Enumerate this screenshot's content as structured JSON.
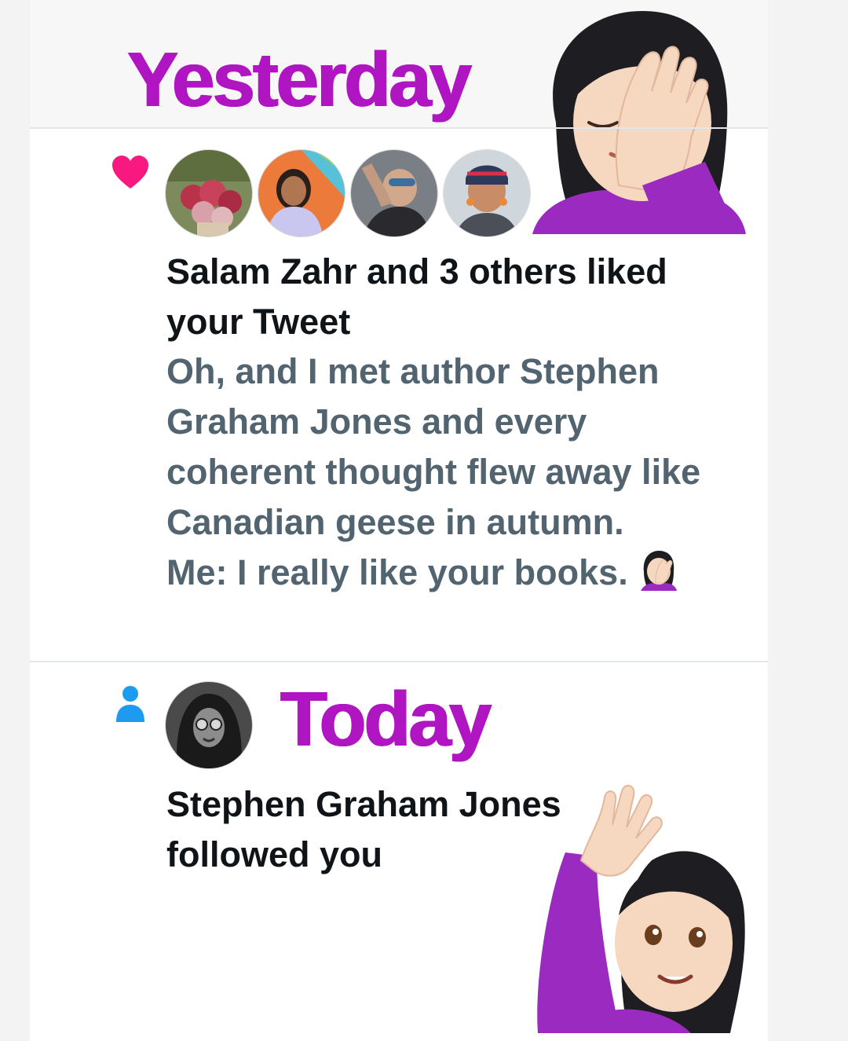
{
  "sections": {
    "yesterday": {
      "heading": "Yesterday"
    },
    "today": {
      "heading": "Today"
    }
  },
  "like_notification": {
    "icon": "heart-icon",
    "icon_color": "#f91880",
    "actor": "Salam Zahr",
    "text": "Salam Zahr and 3 others liked your Tweet",
    "tweet_text": "Oh, and I met author Stephen Graham Jones and every coherent thought flew away like Canadian geese in autumn.\nMe: I really like your books.",
    "avatars": [
      "avatar-radishes",
      "avatar-woman-rainbow",
      "avatar-woman-sunglasses",
      "avatar-woman-headscarf"
    ]
  },
  "follow_notification": {
    "icon": "person-icon",
    "icon_color": "#1d9bf0",
    "actor": "Stephen Graham Jones",
    "text": "Stephen Graham Jones followed you",
    "avatar": "avatar-man-long-hair"
  },
  "decorations": [
    "face-palm-emoji",
    "raising-hand-emoji"
  ],
  "colors": {
    "heading": "#b015c2",
    "primary_text": "#0f1419",
    "secondary_text": "#536471",
    "divider": "#e3e6ea"
  }
}
